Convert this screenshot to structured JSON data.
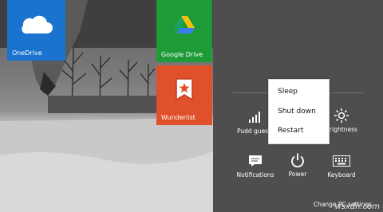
{
  "tiles": {
    "onedrive": {
      "label": "OneDrive",
      "color": "#1a74cf"
    },
    "gdrive": {
      "label": "Google Drive",
      "color": "#1e9a37"
    },
    "wunderlist": {
      "label": "Wunderlist",
      "color": "#e0502a"
    }
  },
  "settings": {
    "network_label": "Pudd gues",
    "brightness_label": "Brightness",
    "notifications_label": "Notifications",
    "power_label": "Power",
    "keyboard_label": "Keyboard",
    "change_pc_settings": "Change PC settings"
  },
  "power_menu": {
    "items": [
      "Sleep",
      "Shut down",
      "Restart"
    ]
  },
  "watermark": "wsxdn.com"
}
